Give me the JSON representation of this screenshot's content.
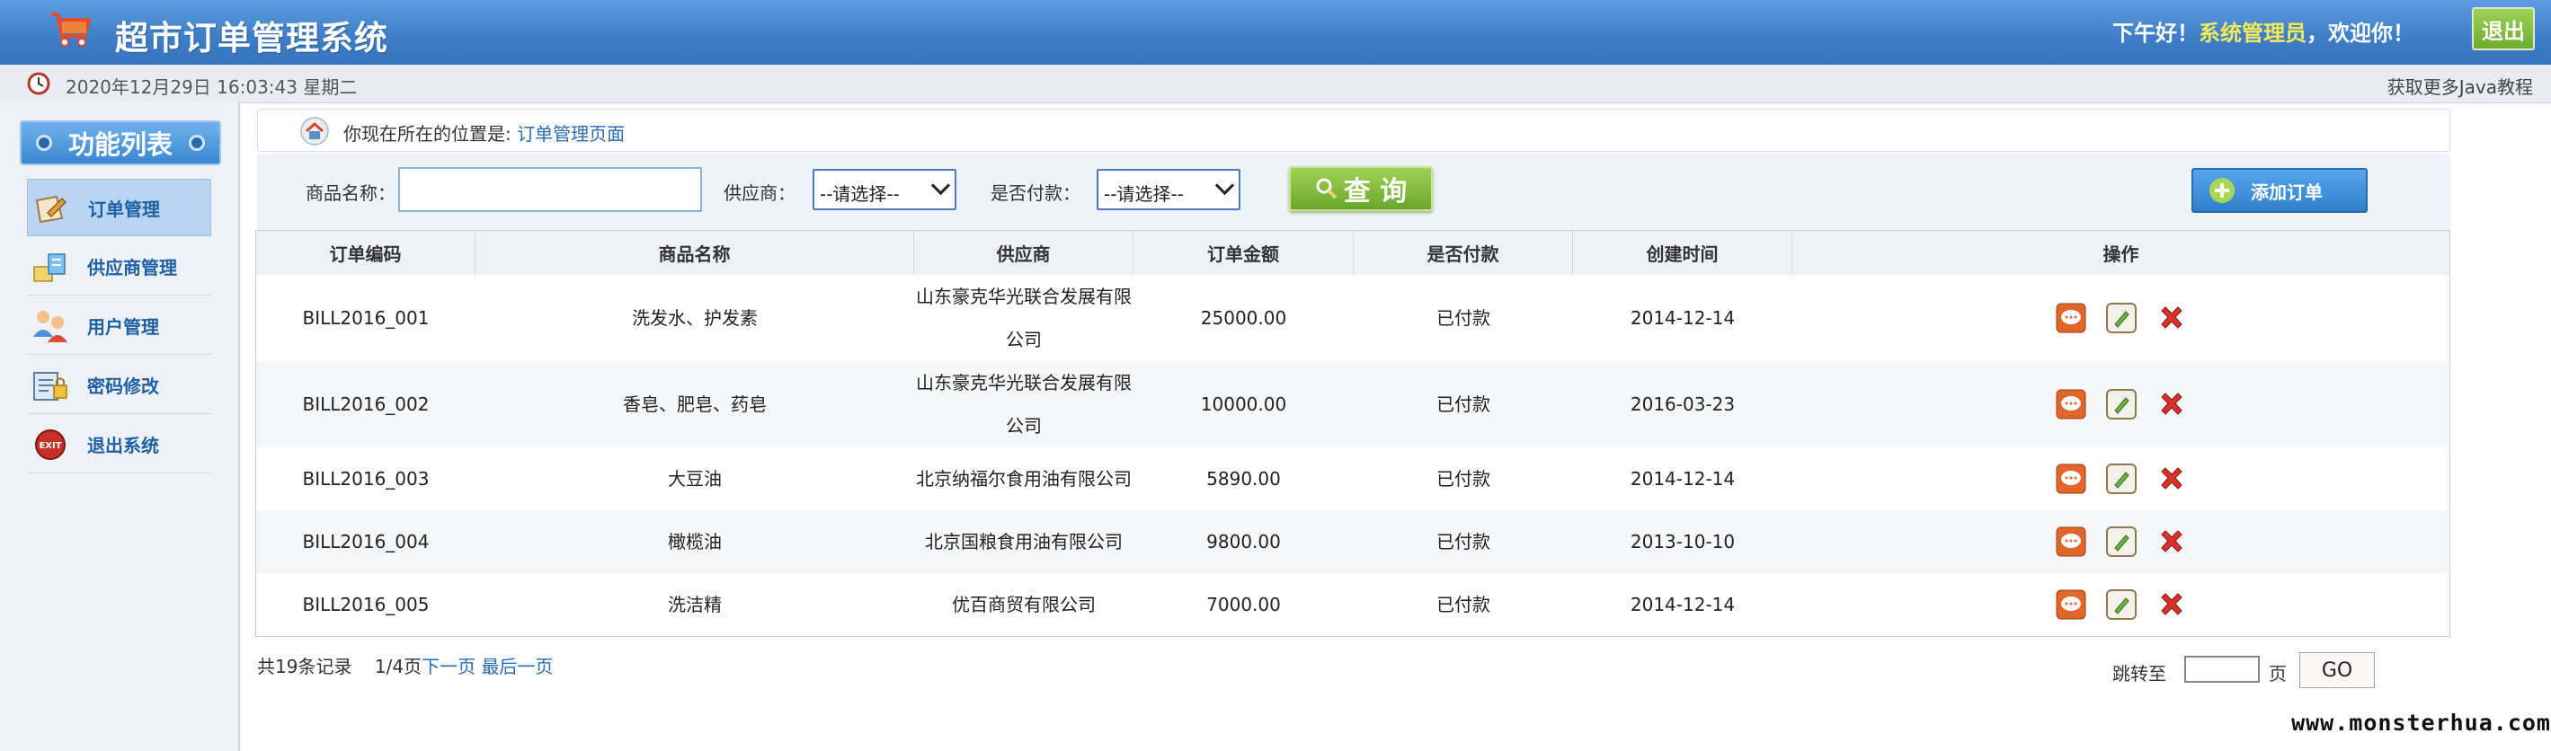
{
  "header": {
    "title": "超市订单管理系统",
    "greeting_prefix": "下午好！",
    "username": "系统管理员",
    "greeting_suffix": "，欢迎你！",
    "logout": "退出"
  },
  "timebar": {
    "datetime": "2020年12月29日 16:03:43 星期二",
    "more": "获取更多Java教程"
  },
  "sidebar": {
    "title": "功能列表",
    "items": [
      {
        "label": "订单管理",
        "icon": "order-icon",
        "active": true
      },
      {
        "label": "供应商管理",
        "icon": "supplier-icon",
        "active": false
      },
      {
        "label": "用户管理",
        "icon": "users-icon",
        "active": false
      },
      {
        "label": "密码修改",
        "icon": "password-icon",
        "active": false
      },
      {
        "label": "退出系统",
        "icon": "exit-icon",
        "active": false
      }
    ]
  },
  "breadcrumb": {
    "prefix": "你现在所在的位置是:",
    "location": "订单管理页面"
  },
  "search": {
    "product_label": "商品名称：",
    "product_value": "",
    "supplier_label": "供应商：",
    "supplier_selected": "--请选择--",
    "paid_label": "是否付款：",
    "paid_selected": "--请选择--",
    "query": "查 询",
    "add": "添加订单"
  },
  "table": {
    "headers": [
      "订单编码",
      "商品名称",
      "供应商",
      "订单金额",
      "是否付款",
      "创建时间",
      "操作"
    ],
    "rows": [
      {
        "code": "BILL2016_001",
        "product": "洗发水、护发素",
        "supplier_l1": "山东豪克华光联合发展有限",
        "supplier_l2": "公司",
        "amount": "25000.00",
        "paid": "已付款",
        "created": "2014-12-14"
      },
      {
        "code": "BILL2016_002",
        "product": "香皂、肥皂、药皂",
        "supplier_l1": "山东豪克华光联合发展有限",
        "supplier_l2": "公司",
        "amount": "10000.00",
        "paid": "已付款",
        "created": "2016-03-23"
      },
      {
        "code": "BILL2016_003",
        "product": "大豆油",
        "supplier_l1": "北京纳福尔食用油有限公司",
        "supplier_l2": "",
        "amount": "5890.00",
        "paid": "已付款",
        "created": "2014-12-14"
      },
      {
        "code": "BILL2016_004",
        "product": "橄榄油",
        "supplier_l1": "北京国粮食用油有限公司",
        "supplier_l2": "",
        "amount": "9800.00",
        "paid": "已付款",
        "created": "2013-10-10"
      },
      {
        "code": "BILL2016_005",
        "product": "洗洁精",
        "supplier_l1": "优百商贸有限公司",
        "supplier_l2": "",
        "amount": "7000.00",
        "paid": "已付款",
        "created": "2014-12-14"
      }
    ]
  },
  "pager": {
    "total": "共19条记录",
    "page": "1/4页",
    "next": "下一页",
    "last": "最后一页",
    "jump_label": "跳转至",
    "jump_value": "",
    "unit": "页",
    "go": "GO"
  },
  "watermark": "www.monsterhua.com",
  "colors": {
    "header": "#3f7fc9",
    "accent_green": "#6eaa2d",
    "link": "#2a6bb5",
    "username": "#f5ea5a"
  }
}
